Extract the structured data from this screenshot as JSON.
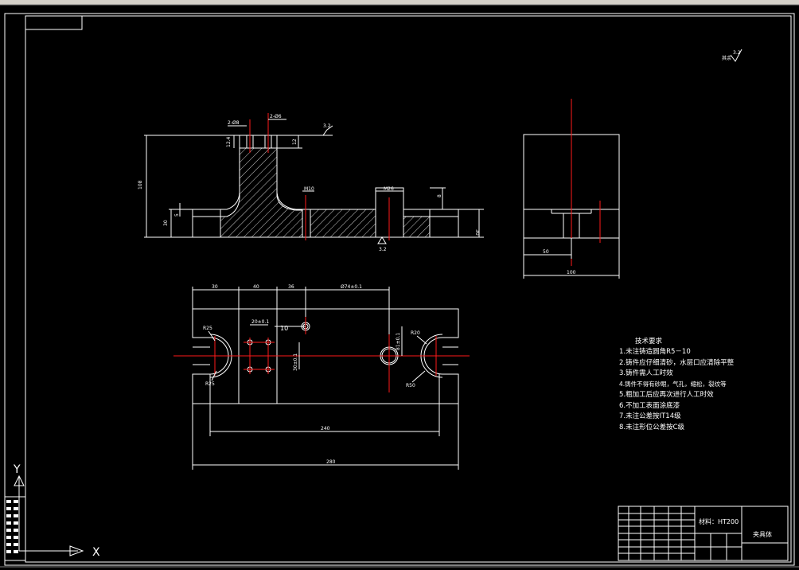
{
  "tech_requirements": {
    "title": "技术要求",
    "items": [
      "1.未注铸造圆角R5－10",
      "2.铸件应仔细清砂，水层口应清除平整",
      "3.铸件需人工时效",
      "4.铸件不得有砂眼，气孔，缩松，裂纹等",
      "5.粗加工后应再次进行人工时效",
      "6.不加工表面涂底漆",
      "7.未注公差按IT14级",
      "8.未注形位公差按C级"
    ]
  },
  "title_block": {
    "material": "材料：HT200",
    "part_name": "夹具体"
  },
  "surface_note": {
    "label": "其余",
    "value": "3.2"
  },
  "ucs": {
    "y_label": "Y",
    "x_label": "X"
  },
  "section_view": {
    "dims": {
      "height_total": "108",
      "base_left": "30",
      "base_right": "30",
      "step_small": "5",
      "rib_12_4": "12.4",
      "top_12": "12",
      "hole_note_1": "2-Ø8",
      "hole_note_2": "2-Ø6",
      "roughness_top": "3.2",
      "m10": "M10",
      "m26": "M26",
      "depth_8": "8",
      "roughness_bottom": "3.2"
    }
  },
  "side_view": {
    "dims": {
      "w50": "50",
      "w100": "100"
    }
  },
  "plan_view": {
    "dims": {
      "d30": "30",
      "d40": "40",
      "d36": "36",
      "d74": "Ø74±0.1",
      "d20": "20±0.1",
      "d10": "10",
      "d30v": "30±0.1",
      "d81": "81±0.1",
      "r25a": "R25",
      "r25b": "R25",
      "r20": "R20",
      "r50": "R50",
      "d240": "240",
      "d280": "280"
    }
  }
}
